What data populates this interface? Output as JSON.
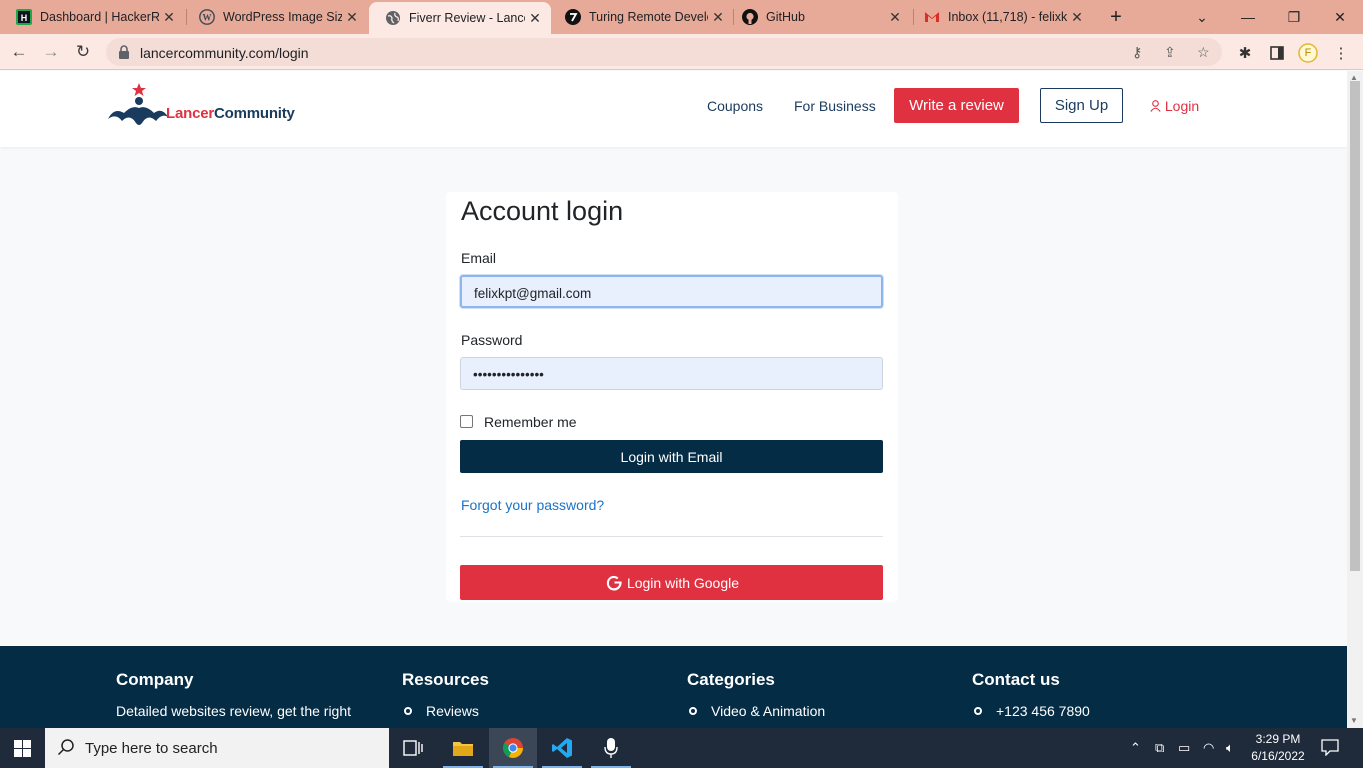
{
  "browser": {
    "tabs": [
      {
        "title": "Dashboard | HackerRa",
        "icon": "hackerrank-icon"
      },
      {
        "title": "WordPress Image Size",
        "icon": "wordpress-icon"
      },
      {
        "title": "Fiverr Review - Lancer",
        "icon": "globe-icon",
        "active": true
      },
      {
        "title": "Turing Remote Develo",
        "icon": "turing-icon"
      },
      {
        "title": "GitHub",
        "icon": "github-icon"
      },
      {
        "title": "Inbox (11,718) - felixk",
        "icon": "gmail-icon"
      }
    ],
    "url": "lancercommunity.com/login",
    "profile_initial": "F"
  },
  "site": {
    "brand_part1": "Lancer",
    "brand_part2": "Community",
    "nav": {
      "coupons": "Coupons",
      "for_business": "For Business",
      "write_review": "Write a review",
      "sign_up": "Sign Up",
      "login": "Login"
    }
  },
  "login": {
    "title": "Account login",
    "email_label": "Email",
    "email_value": "felixkpt@gmail.com",
    "password_label": "Password",
    "password_value": "•••••••••••••••",
    "remember_label": "Remember me",
    "email_button": "Login with Email",
    "forgot": "Forgot your password?",
    "google_button": "Login with Google"
  },
  "footer": {
    "company": {
      "heading": "Company",
      "text": "Detailed websites review, get the right"
    },
    "resources": {
      "heading": "Resources",
      "items": [
        "Reviews"
      ]
    },
    "categories": {
      "heading": "Categories",
      "items": [
        "Video & Animation"
      ]
    },
    "contact": {
      "heading": "Contact us",
      "items": [
        "+123 456 7890"
      ]
    }
  },
  "taskbar": {
    "search_placeholder": "Type here to search",
    "time": "3:29 PM",
    "date": "6/16/2022"
  },
  "colors": {
    "accent_red": "#e03141",
    "navy": "#052c45",
    "tab_bar": "#e8aa98"
  }
}
